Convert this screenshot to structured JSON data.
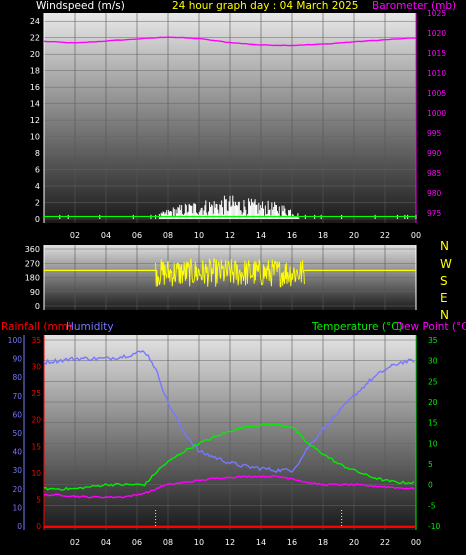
{
  "header": {
    "wind_label": "Windspeed (m/s)",
    "title": "24 hour graph day : 04 March 2025",
    "baro_label": "Barometer (mb)"
  },
  "middle": {
    "compass": [
      "N",
      "W",
      "S",
      "E",
      "N"
    ]
  },
  "lower_header": {
    "rain_label": "Rainfall (mm)",
    "hum_label": "Humidity",
    "temp_label": "Temperature (°C)",
    "dew_label": "Dew Point (°C)"
  },
  "colors": {
    "wind": "#ffffff",
    "gust": "#00ff00",
    "baro": "#ff00ff",
    "direction": "#ffff00",
    "rain": "#ff0000",
    "humidity": "#7777ff",
    "temperature": "#00ee00",
    "dewpoint": "#ff00ff",
    "title": "#ffff00"
  },
  "chart_data": [
    {
      "type": "line",
      "x_tick_labels": [
        "02",
        "04",
        "06",
        "08",
        "10",
        "12",
        "14",
        "16",
        "18",
        "20",
        "22",
        "00"
      ],
      "series": [
        {
          "name": "Windspeed (m/s)",
          "x": [
            0,
            6,
            7.2,
            8,
            9,
            10,
            11,
            12,
            13,
            14,
            15,
            16,
            16.6,
            17,
            24
          ],
          "values": [
            0.2,
            0.2,
            0.3,
            1.0,
            1.5,
            1.8,
            2.0,
            2.3,
            2.0,
            1.8,
            1.6,
            1.2,
            0.3,
            0.2,
            0.2
          ]
        },
        {
          "name": "Barometer (mb)",
          "x": [
            0,
            2,
            4,
            6,
            8,
            10,
            12,
            14,
            16,
            18,
            20,
            22,
            24
          ],
          "values": [
            1017.9,
            1017.5,
            1018.0,
            1018.5,
            1019.0,
            1018.6,
            1017.6,
            1017.0,
            1016.9,
            1017.2,
            1017.8,
            1018.3,
            1018.8
          ]
        }
      ],
      "y_left": {
        "label": "Windspeed (m/s)",
        "ticks": [
          "0",
          "2",
          "4",
          "6",
          "8",
          "10",
          "12",
          "14",
          "16",
          "18",
          "20",
          "22",
          "24"
        ],
        "range": [
          0,
          25
        ]
      },
      "y_right": {
        "label": "Barometer (mb)",
        "ticks": [
          "975",
          "980",
          "985",
          "990",
          "995",
          "1000",
          "1005",
          "1010",
          "1015",
          "1020",
          "1025"
        ],
        "range": [
          973.5,
          1025
        ]
      }
    },
    {
      "type": "scatter",
      "x_tick_labels": [],
      "series": [
        {
          "name": "Wind direction",
          "x": [
            0,
            7,
            7.3,
            24
          ],
          "values": [
            225,
            225,
            225,
            225
          ]
        }
      ],
      "scatter_window": [
        7.2,
        16.8
      ],
      "y_left": {
        "ticks": [
          "360",
          "270",
          "180",
          "90",
          "0"
        ],
        "range": [
          0,
          360
        ]
      }
    },
    {
      "type": "line",
      "x_tick_labels": [
        "02",
        "04",
        "06",
        "08",
        "10",
        "12",
        "14",
        "16",
        "18",
        "20",
        "22",
        "00"
      ],
      "series": [
        {
          "name": "Humidity",
          "x": [
            0,
            1,
            2,
            3,
            4,
            5,
            6,
            6.5,
            7,
            7.5,
            8,
            9,
            10,
            11,
            12,
            13,
            14,
            15,
            16,
            16.5,
            17,
            18,
            19,
            20,
            21,
            22,
            23,
            24
          ],
          "values": [
            88,
            89,
            90,
            90,
            90,
            91,
            93,
            94,
            88,
            78,
            66,
            51,
            40,
            37,
            34,
            32,
            31,
            30,
            30,
            35,
            42,
            52,
            61,
            70,
            78,
            84,
            88,
            89
          ]
        },
        {
          "name": "Temperature (°C)",
          "x": [
            0,
            1,
            2,
            3,
            4,
            5,
            6,
            6.5,
            7,
            7.5,
            8,
            9,
            10,
            11,
            12,
            13,
            14,
            15,
            16,
            16.5,
            17,
            18,
            19,
            20,
            21,
            22,
            23,
            24
          ],
          "values": [
            -1,
            -1,
            -1,
            -0.5,
            0,
            0,
            0,
            0,
            2,
            4,
            5.5,
            8,
            10,
            11.5,
            13,
            14,
            14.5,
            14.5,
            14,
            12,
            10,
            7.5,
            5,
            3.5,
            2,
            1,
            0.5,
            0.5
          ]
        },
        {
          "name": "Dew Point (°C)",
          "x": [
            0,
            1,
            2,
            3,
            4,
            5,
            6,
            6.5,
            7,
            7.5,
            8,
            9,
            10,
            11,
            12,
            13,
            14,
            15,
            16,
            16.5,
            17,
            18,
            19,
            20,
            21,
            22,
            23,
            24
          ],
          "values": [
            -2.5,
            -2.5,
            -2.8,
            -3,
            -3,
            -3,
            -2.5,
            -2,
            -1.5,
            -0.5,
            0,
            0.5,
            1,
            1.5,
            1.8,
            2,
            2,
            2,
            1.5,
            1,
            0.5,
            0,
            0,
            0,
            -0.3,
            -0.5,
            -0.8,
            -1
          ]
        },
        {
          "name": "Rainfall (mm)",
          "x": [
            0,
            24
          ],
          "values": [
            0,
            0
          ]
        }
      ],
      "y_left_humidity": {
        "label": "Humidity",
        "ticks": [
          "0",
          "10",
          "20",
          "30",
          "40",
          "50",
          "60",
          "70",
          "80",
          "90",
          "100"
        ],
        "range": [
          0,
          100
        ]
      },
      "y_left_rain": {
        "label": "Rainfall (mm)",
        "ticks": [
          "0",
          "5",
          "10",
          "15",
          "20",
          "25",
          "30",
          "35"
        ],
        "range": [
          0,
          35
        ]
      },
      "y_right": {
        "label": "Temperature (°C)",
        "ticks": [
          "-10",
          "-5",
          "0",
          "5",
          "10",
          "15",
          "20",
          "25",
          "30",
          "35"
        ],
        "range": [
          -10,
          35
        ]
      }
    }
  ]
}
